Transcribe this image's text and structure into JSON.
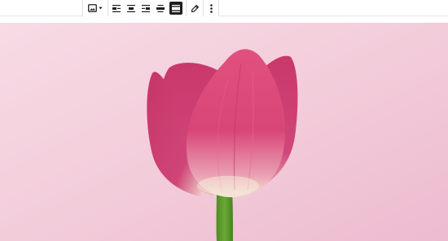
{
  "toolbar": {
    "buttons": [
      {
        "name": "image-block-switcher",
        "icon": "image-icon",
        "has_dropdown": true
      },
      {
        "name": "align-left",
        "icon": "align-left-icon"
      },
      {
        "name": "align-center",
        "icon": "align-center-icon"
      },
      {
        "name": "align-right",
        "icon": "align-right-icon"
      },
      {
        "name": "align-wide",
        "icon": "align-wide-icon"
      },
      {
        "name": "align-full",
        "icon": "align-full-width-icon",
        "active": true
      },
      {
        "name": "edit",
        "icon": "pencil-icon"
      },
      {
        "name": "more-options",
        "icon": "more-vertical-icon"
      }
    ]
  },
  "image": {
    "subject": "pink tulip",
    "background_color": "#f3cbd9",
    "petal_color": "#d23f70",
    "stem_color": "#5d9a2c"
  }
}
